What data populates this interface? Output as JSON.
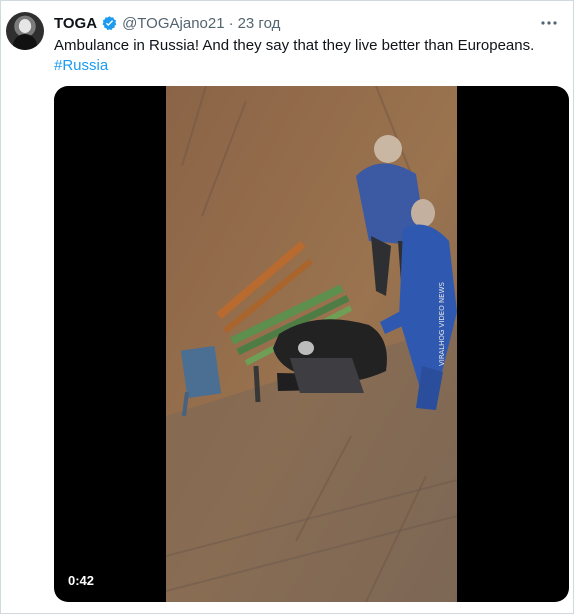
{
  "author": {
    "display_name": "TOGA",
    "handle": "@TOGAjano21",
    "separator": "·",
    "timestamp": "23 год",
    "verified_icon": "verified-badge-icon"
  },
  "tweet": {
    "text": "Ambulance in Russia! And they say that they live better than Europeans.",
    "hashtag": "#Russia"
  },
  "media": {
    "duration": "0:42",
    "watermark": "VIRALHOG VIDEO NEWS"
  },
  "menu": {
    "more_icon": "more-icon"
  },
  "colors": {
    "accent": "#1d9bf0",
    "secondary_text": "#536471",
    "primary_text": "#0f1419",
    "border": "#cfd9de"
  }
}
